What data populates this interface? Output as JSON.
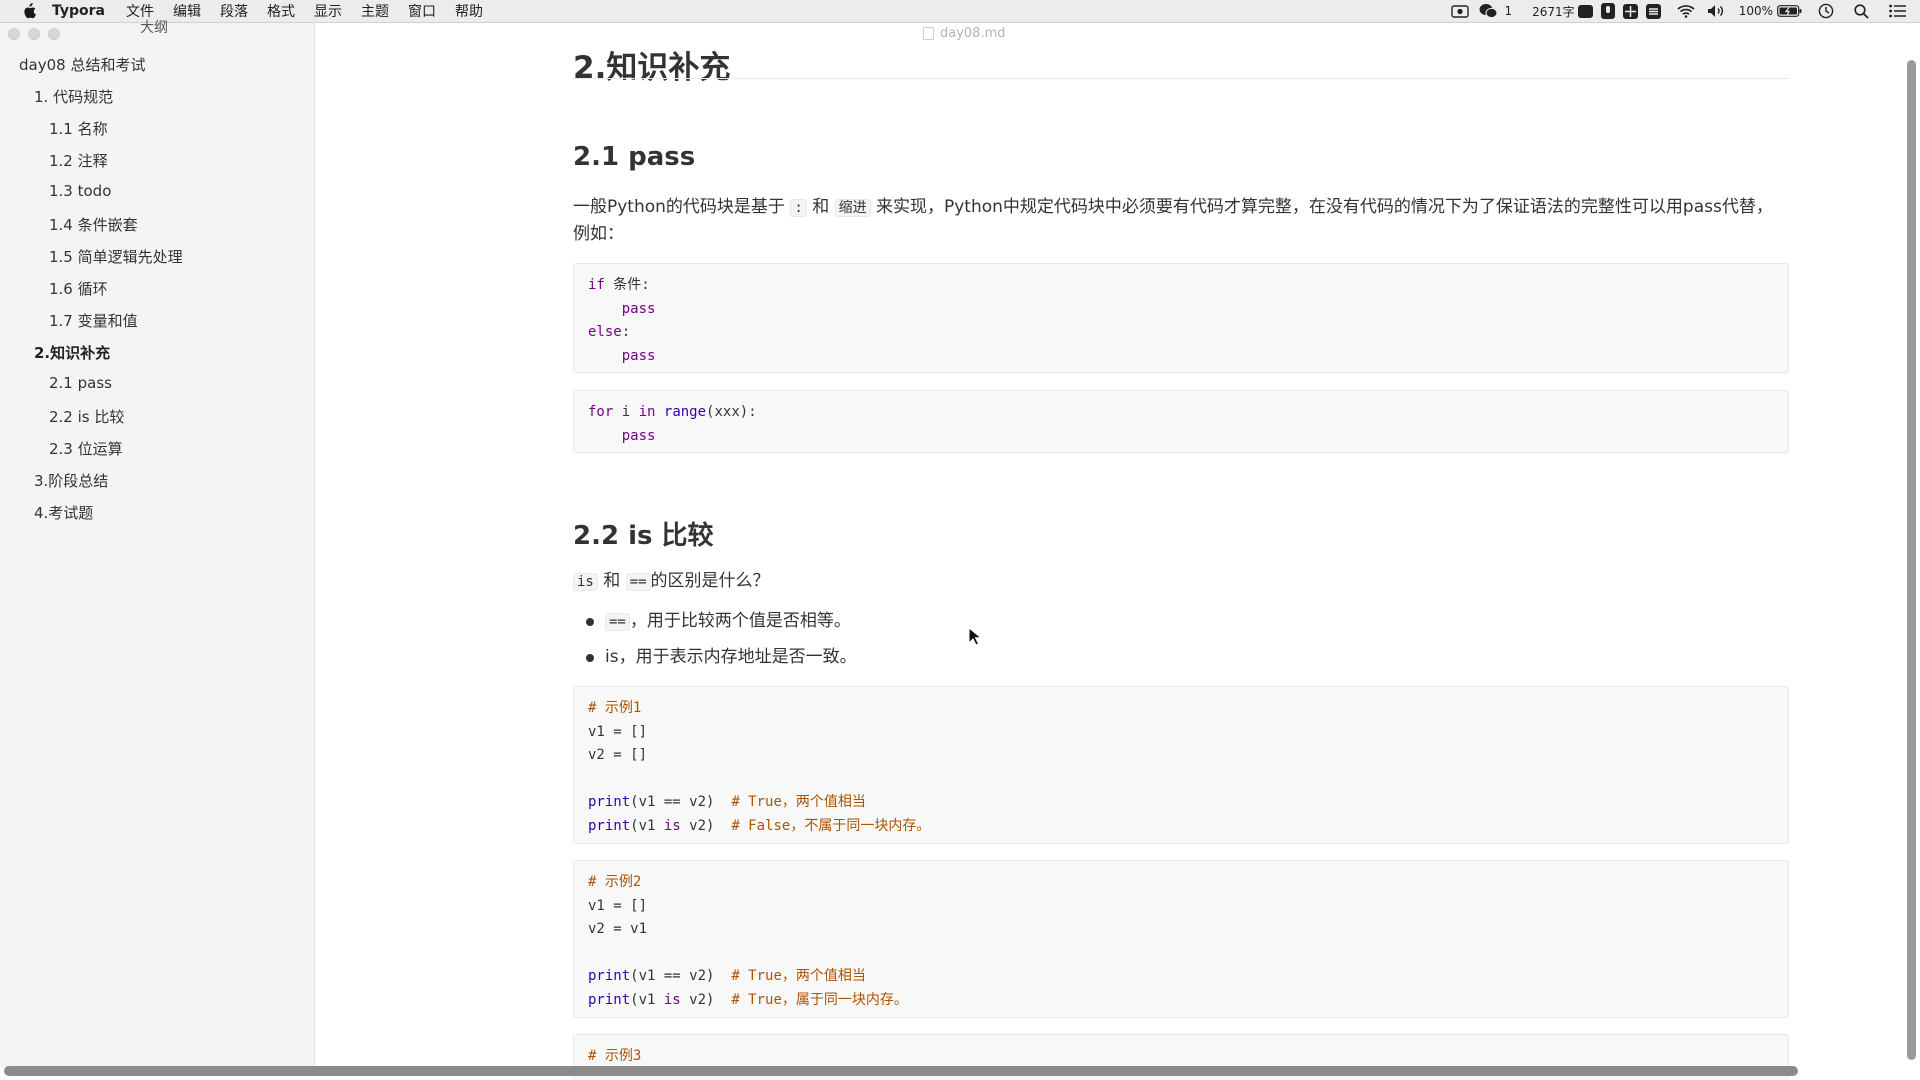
{
  "menubar": {
    "app_name": "Typora",
    "menus": [
      "文件",
      "编辑",
      "段落",
      "格式",
      "显示",
      "主题",
      "窗口",
      "帮助"
    ],
    "status": {
      "wechat_count": "1",
      "word_count": "2671字",
      "battery": "100%"
    }
  },
  "sidebar": {
    "title": "大纲",
    "items": [
      {
        "label": "day08 总结和考试"
      },
      {
        "label": "1. 代码规范"
      },
      {
        "label": "1.1 名称"
      },
      {
        "label": "1.2 注释"
      },
      {
        "label": "1.3 todo"
      },
      {
        "label": "1.4 条件嵌套"
      },
      {
        "label": "1.5 简单逻辑先处理"
      },
      {
        "label": "1.6 循环"
      },
      {
        "label": "1.7 变量和值"
      },
      {
        "label": "2.知识补充"
      },
      {
        "label": "2.1 pass"
      },
      {
        "label": "2.2 is 比较"
      },
      {
        "label": "2.3 位运算"
      },
      {
        "label": "3.阶段总结"
      },
      {
        "label": "4.考试题"
      }
    ]
  },
  "document": {
    "filename": "day08.md",
    "h1": "2.知识补充",
    "sec_pass": {
      "heading": "2.1 pass",
      "para": {
        "p1": "一般Python的代码块是基于",
        "c1": ":",
        "p2": "和",
        "c2": "缩进",
        "p3": "来实现，Python中规定代码块中必须要有代码才算完整，在没有代码的情况下为了保证语法的完整性可以用pass代替，例如："
      },
      "code1": {
        "l1": {
          "kw": "if",
          "rest": " 条件:"
        },
        "l2": {
          "indent": "    ",
          "kw": "pass"
        },
        "l3": {
          "kw": "else",
          "rest": ":"
        },
        "l4": {
          "indent": "    ",
          "kw": "pass"
        }
      },
      "code2": {
        "l1": {
          "kw1": "for",
          "t1": " i ",
          "kw2": "in",
          "t2": " ",
          "bi": "range",
          "t3": "(xxx):"
        },
        "l2": {
          "indent": "    ",
          "kw": "pass"
        }
      }
    },
    "sec_is": {
      "heading": "2.2 is 比较",
      "question": {
        "c1": "is",
        "p1": "和",
        "c2": "==",
        "p2": "的区别是什么？"
      },
      "bullet1": {
        "code": "==",
        "text": "，用于比较两个值是否相等。"
      },
      "bullet2": {
        "text": "is，用于表示内存地址是否一致。"
      },
      "ex1": {
        "comment": "# 示例1",
        "l2": "v1 = []",
        "l3": "v2 = []",
        "l5": {
          "fn": "print",
          "args": "(v1 == v2)  ",
          "cm": "# True，两个值相当"
        },
        "l6": {
          "fn": "print",
          "a1": "(v1 ",
          "kw": "is",
          "a2": " v2)  ",
          "cm": "# False，不属于同一块内存。"
        }
      },
      "ex2": {
        "comment": "# 示例2",
        "l2": "v1 = []",
        "l3": "v2 = v1",
        "l5": {
          "fn": "print",
          "args": "(v1 == v2)  ",
          "cm": "# True，两个值相当"
        },
        "l6": {
          "fn": "print",
          "a1": "(v1 ",
          "kw": "is",
          "a2": " v2)  ",
          "cm": "# True，属于同一块内存。"
        }
      },
      "ex3": {
        "comment": "# 示例3"
      }
    }
  },
  "colors": {
    "keyword": "#770088",
    "builtin": "#3300aa",
    "comment": "#aa5500",
    "code_bg": "#f8f8f8"
  }
}
